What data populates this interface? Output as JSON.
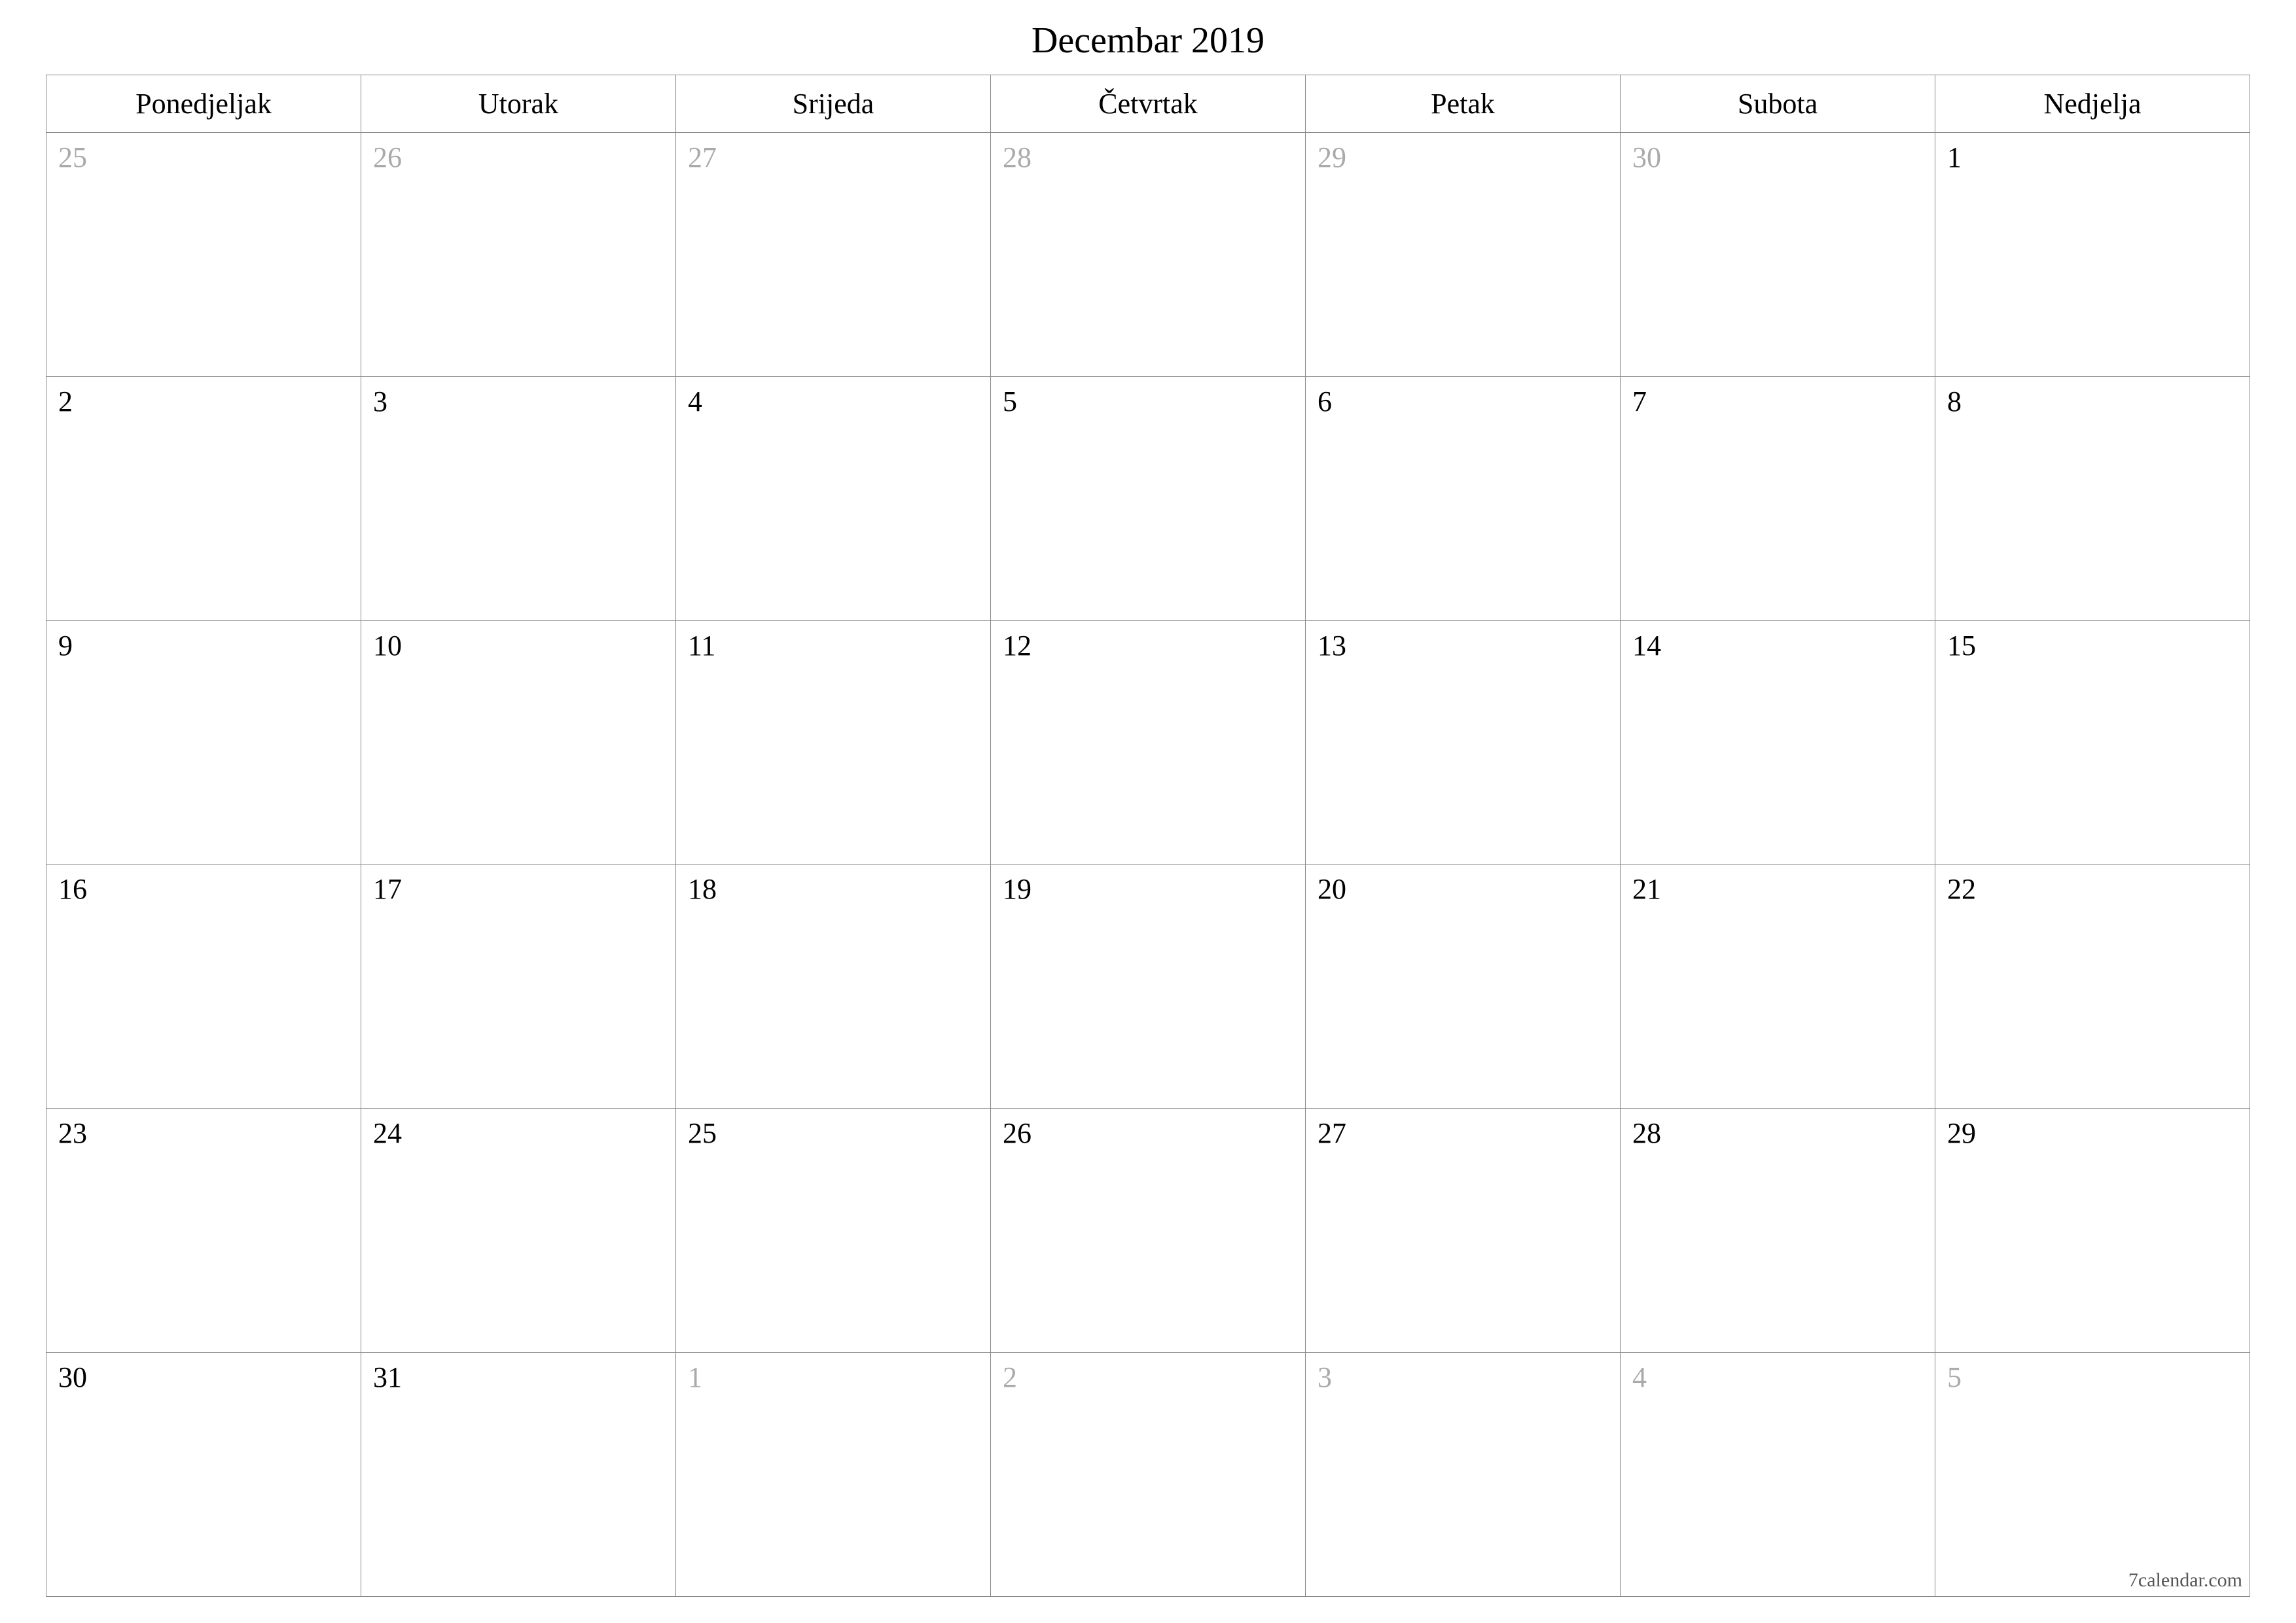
{
  "title": "Decembar 2019",
  "weekdays": [
    "Ponedjeljak",
    "Utorak",
    "Srijeda",
    "Četvrtak",
    "Petak",
    "Subota",
    "Nedjelja"
  ],
  "weeks": [
    [
      {
        "day": "25",
        "other": true
      },
      {
        "day": "26",
        "other": true
      },
      {
        "day": "27",
        "other": true
      },
      {
        "day": "28",
        "other": true
      },
      {
        "day": "29",
        "other": true
      },
      {
        "day": "30",
        "other": true
      },
      {
        "day": "1",
        "other": false
      }
    ],
    [
      {
        "day": "2",
        "other": false
      },
      {
        "day": "3",
        "other": false
      },
      {
        "day": "4",
        "other": false
      },
      {
        "day": "5",
        "other": false
      },
      {
        "day": "6",
        "other": false
      },
      {
        "day": "7",
        "other": false
      },
      {
        "day": "8",
        "other": false
      }
    ],
    [
      {
        "day": "9",
        "other": false
      },
      {
        "day": "10",
        "other": false
      },
      {
        "day": "11",
        "other": false
      },
      {
        "day": "12",
        "other": false
      },
      {
        "day": "13",
        "other": false
      },
      {
        "day": "14",
        "other": false
      },
      {
        "day": "15",
        "other": false
      }
    ],
    [
      {
        "day": "16",
        "other": false
      },
      {
        "day": "17",
        "other": false
      },
      {
        "day": "18",
        "other": false
      },
      {
        "day": "19",
        "other": false
      },
      {
        "day": "20",
        "other": false
      },
      {
        "day": "21",
        "other": false
      },
      {
        "day": "22",
        "other": false
      }
    ],
    [
      {
        "day": "23",
        "other": false
      },
      {
        "day": "24",
        "other": false
      },
      {
        "day": "25",
        "other": false
      },
      {
        "day": "26",
        "other": false
      },
      {
        "day": "27",
        "other": false
      },
      {
        "day": "28",
        "other": false
      },
      {
        "day": "29",
        "other": false
      }
    ],
    [
      {
        "day": "30",
        "other": false
      },
      {
        "day": "31",
        "other": false
      },
      {
        "day": "1",
        "other": true
      },
      {
        "day": "2",
        "other": true
      },
      {
        "day": "3",
        "other": true
      },
      {
        "day": "4",
        "other": true
      },
      {
        "day": "5",
        "other": true
      }
    ]
  ],
  "footer": "7calendar.com"
}
